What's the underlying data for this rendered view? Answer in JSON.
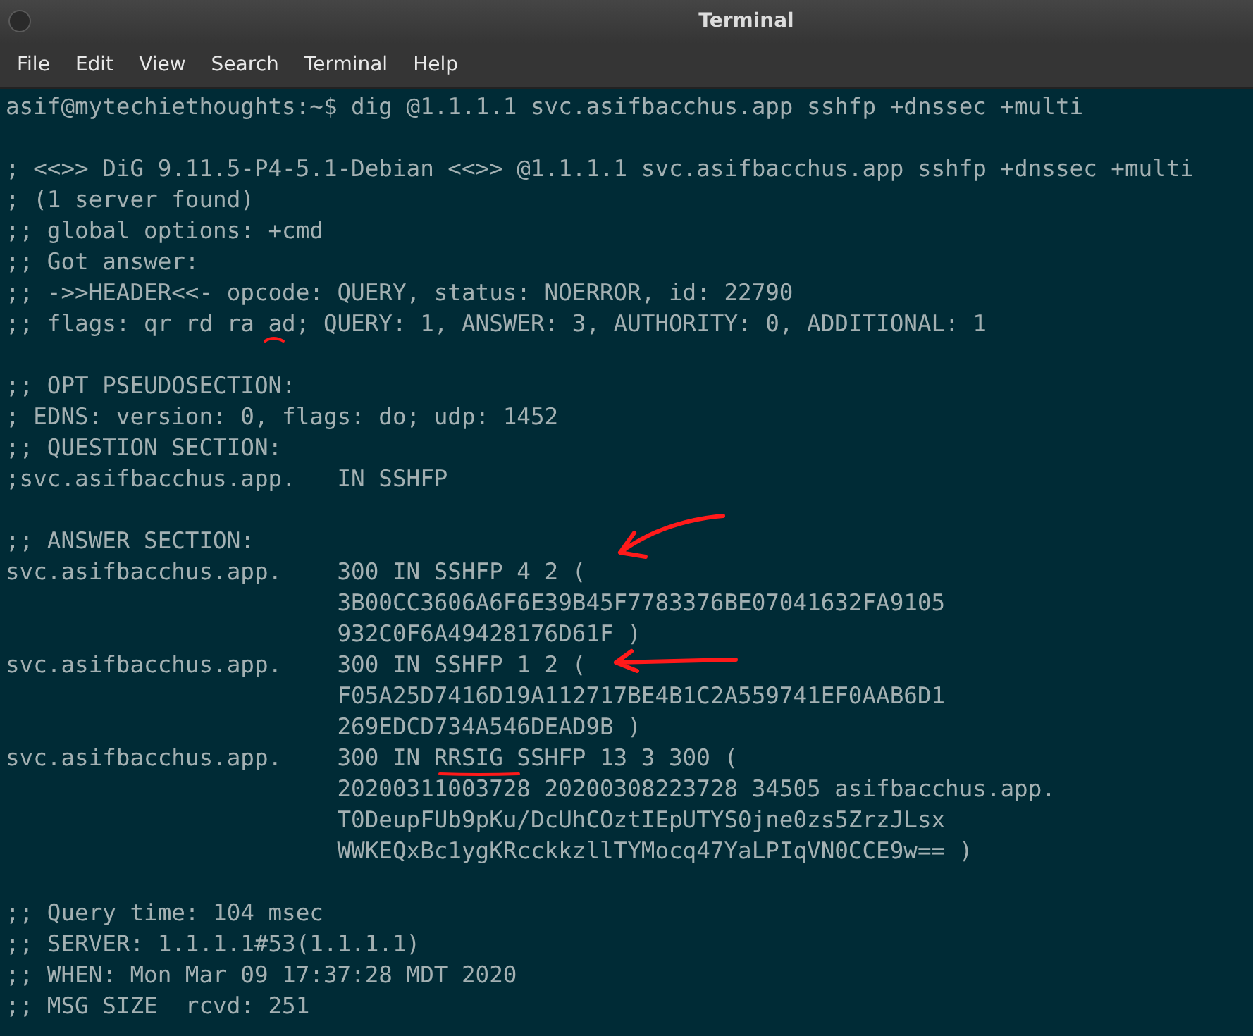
{
  "window": {
    "title": "Terminal"
  },
  "menu": [
    "File",
    "Edit",
    "View",
    "Search",
    "Terminal",
    "Help"
  ],
  "terminal": {
    "blocks": [
      [
        "asif@mytechiethoughts:~$ dig @1.1.1.1 svc.asifbacchus.app sshfp +dnssec +multi"
      ],
      [
        "; <<>> DiG 9.11.5-P4-5.1-Debian <<>> @1.1.1.1 svc.asifbacchus.app sshfp +dnssec +multi",
        "; (1 server found)",
        ";; global options: +cmd",
        ";; Got answer:",
        ";; ->>HEADER<<- opcode: QUERY, status: NOERROR, id: 22790",
        ";; flags: qr rd ra ad; QUERY: 1, ANSWER: 3, AUTHORITY: 0, ADDITIONAL: 1"
      ],
      [
        ";; OPT PSEUDOSECTION:",
        "; EDNS: version: 0, flags: do; udp: 1452",
        ";; QUESTION SECTION:",
        ";svc.asifbacchus.app.   IN SSHFP"
      ],
      [
        ";; ANSWER SECTION:",
        "svc.asifbacchus.app.    300 IN SSHFP 4 2 (",
        "                        3B00CC3606A6F6E39B45F7783376BE07041632FA9105",
        "                        932C0F6A49428176D61F )",
        "svc.asifbacchus.app.    300 IN SSHFP 1 2 (",
        "                        F05A25D7416D19A112717BE4B1C2A559741EF0AAB6D1",
        "                        269EDCD734A546DEAD9B )",
        "svc.asifbacchus.app.    300 IN RRSIG SSHFP 13 3 300 (",
        "                        20200311003728 20200308223728 34505 asifbacchus.app.",
        "                        T0DeupFUb9pKu/DcUhCOztIEpUTYS0jne0zs5ZrzJLsx",
        "                        WWKEQxBc1ygKRcckkzllTYMocq47YaLPIqVN0CCE9w== )"
      ],
      [
        ";; Query time: 104 msec",
        ";; SERVER: 1.1.1.1#53(1.1.1.1)",
        ";; WHEN: Mon Mar 09 17:37:28 MDT 2020",
        ";; MSG SIZE  rcvd: 251"
      ]
    ]
  }
}
